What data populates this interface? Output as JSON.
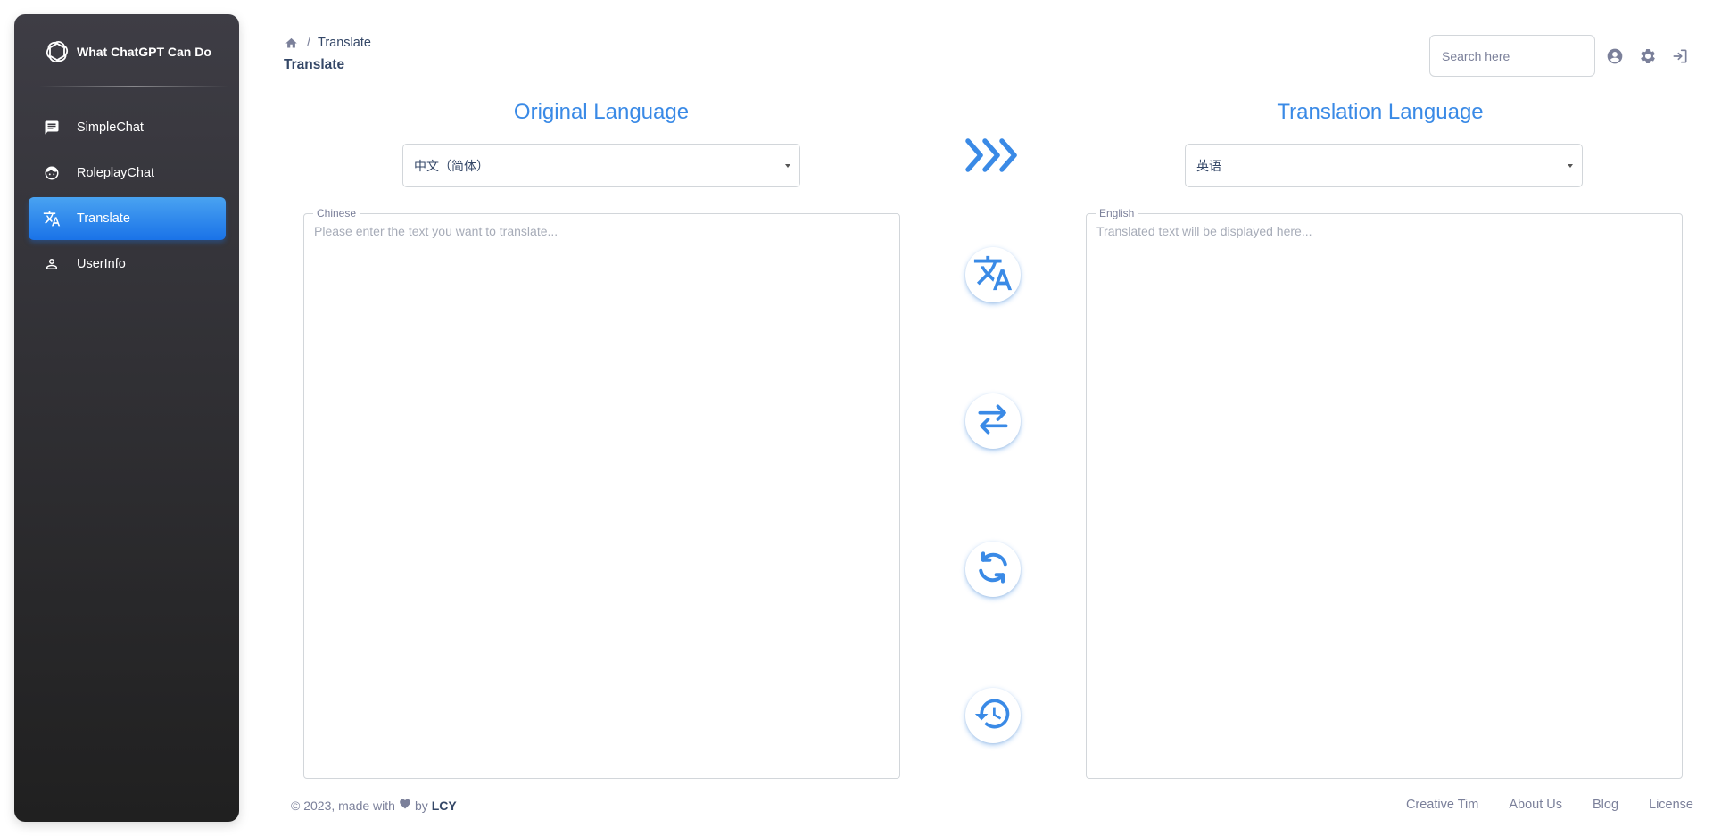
{
  "sidebar": {
    "brand": "What ChatGPT Can Do",
    "items": [
      {
        "label": "SimpleChat",
        "icon": "chat-icon"
      },
      {
        "label": "RoleplayChat",
        "icon": "face-icon"
      },
      {
        "label": "Translate",
        "icon": "translate-icon",
        "active": true
      },
      {
        "label": "UserInfo",
        "icon": "person-icon"
      }
    ]
  },
  "header": {
    "breadcrumb_current": "Translate",
    "title": "Translate",
    "search_placeholder": "Search here",
    "icons": [
      "account-icon",
      "settings-icon",
      "logout-icon"
    ]
  },
  "main": {
    "original": {
      "title": "Original Language",
      "selected": "中文（简体）",
      "legend": "Chinese",
      "placeholder": "Please enter the text you want to translate..."
    },
    "translation": {
      "title": "Translation Language",
      "selected": "英语",
      "legend": "English",
      "placeholder": "Translated text will be displayed here..."
    },
    "actions": [
      "translate-button",
      "swap-button",
      "refresh-button",
      "history-button"
    ]
  },
  "footer": {
    "copyright": "© 2023, made with",
    "by": "by",
    "author": "LCY",
    "links": [
      "Creative Tim",
      "About Us",
      "Blog",
      "License"
    ]
  },
  "colors": {
    "accent": "#3a8ae6",
    "sidebar_top": "#3e3d45",
    "sidebar_bottom": "#202020",
    "active_nav": "#1A73E8"
  }
}
